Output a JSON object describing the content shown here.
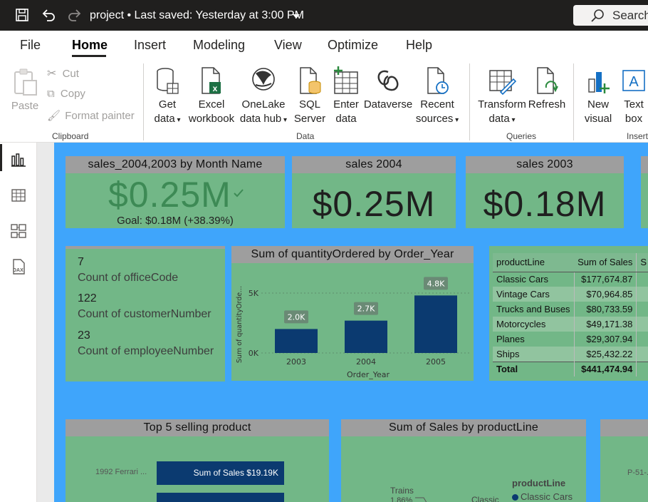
{
  "titlebar": {
    "file_name": "project",
    "saved_status": "Last saved: Yesterday at 3:00 PM",
    "search_placeholder": "Search"
  },
  "menu": [
    "File",
    "Home",
    "Insert",
    "Modeling",
    "View",
    "Optimize",
    "Help"
  ],
  "ribbon": {
    "clipboard": {
      "paste": "Paste",
      "cut": "Cut",
      "copy": "Copy",
      "format_painter": "Format painter",
      "group_label": "Clipboard"
    },
    "data": {
      "get_data": [
        "Get",
        "data"
      ],
      "excel": [
        "Excel",
        "workbook"
      ],
      "onelake": [
        "OneLake",
        "data hub"
      ],
      "sql": [
        "SQL",
        "Server"
      ],
      "enter": [
        "Enter",
        "data"
      ],
      "dataverse": "Dataverse",
      "recent": [
        "Recent",
        "sources"
      ],
      "group_label": "Data"
    },
    "queries": {
      "transform": [
        "Transform",
        "data"
      ],
      "refresh": "Refresh",
      "group_label": "Queries"
    },
    "insert": {
      "new_visual": [
        "New",
        "visual"
      ],
      "text_box": [
        "Text",
        "box"
      ],
      "group_label": "Insert"
    }
  },
  "kpi": {
    "title": "sales_2004,2003 by Month Name",
    "value": "$0.25M",
    "goal": "Goal: $0.18M (+38.39%)"
  },
  "card_2004": {
    "title": "sales 2004",
    "value": "$0.25M"
  },
  "card_2003": {
    "title": "sales 2003",
    "value": "$0.18M"
  },
  "multirow": [
    {
      "value": "7",
      "label": "Count of officeCode"
    },
    {
      "value": "122",
      "label": "Count of customerNumber"
    },
    {
      "value": "23",
      "label": "Count of employeeNumber"
    }
  ],
  "chart_data": {
    "type": "bar",
    "title": "Sum of quantityOrdered by Order_Year",
    "xlabel": "Order_Year",
    "ylabel": "Sum of quantityOrde...",
    "categories": [
      "2003",
      "2004",
      "2005"
    ],
    "values": [
      2000,
      2700,
      4800
    ],
    "data_labels": [
      "2.0K",
      "2.7K",
      "4.8K"
    ],
    "y_ticks": [
      "0K",
      "5K"
    ],
    "ylim": [
      0,
      5000
    ],
    "bar_color": "#0b3a70",
    "grid": true
  },
  "matrix": {
    "headers": [
      "productLine",
      "Sum of Sales",
      "S"
    ],
    "rows": [
      [
        "Classic Cars",
        "$177,674.87"
      ],
      [
        "Vintage Cars",
        "$70,964.85"
      ],
      [
        "Trucks and Buses",
        "$80,733.59"
      ],
      [
        "Motorcycles",
        "$49,171.38"
      ],
      [
        "Planes",
        "$29,307.94"
      ],
      [
        "Ships",
        "$25,432.22"
      ]
    ],
    "total": [
      "Total",
      "$441,474.94"
    ]
  },
  "top5": {
    "title": "Top 5 selling product",
    "row1_label": "1992 Ferrari ...",
    "row1_value": "Sum of Sales $19.19K"
  },
  "pie": {
    "title": "Sum of Sales by productLine",
    "legend_title": "productLine",
    "legend_item": "Classic Cars",
    "label_trains": "Trains",
    "label_pct": "1.86%",
    "label_classic": "Classic"
  },
  "partial": {
    "label": "P-51-..."
  },
  "colors": {
    "canvas": "#3fa5fb",
    "card": "#72b787",
    "header": "#9e9e9e",
    "bar": "#0b3a70"
  }
}
